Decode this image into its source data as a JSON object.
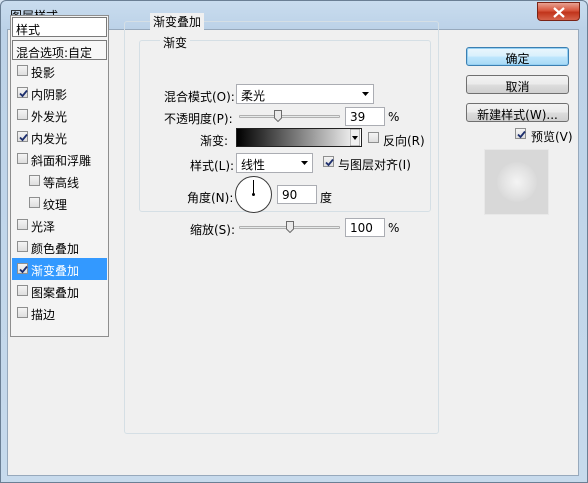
{
  "window": {
    "title": "图层样式"
  },
  "style_list": {
    "header": "样式",
    "blend_options": "混合选项:自定",
    "items": [
      {
        "label": "投影",
        "checked": false
      },
      {
        "label": "内阴影",
        "checked": true
      },
      {
        "label": "外发光",
        "checked": false
      },
      {
        "label": "内发光",
        "checked": true
      },
      {
        "label": "斜面和浮雕",
        "checked": false
      },
      {
        "label": "等高线",
        "checked": false
      },
      {
        "label": "纹理",
        "checked": false
      },
      {
        "label": "光泽",
        "checked": false
      },
      {
        "label": "颜色叠加",
        "checked": false
      },
      {
        "label": "渐变叠加",
        "checked": true,
        "selected": true
      },
      {
        "label": "图案叠加",
        "checked": false
      },
      {
        "label": "描边",
        "checked": false
      }
    ]
  },
  "panel": {
    "group_title": "渐变叠加",
    "sub_group_title": "渐变",
    "blend_mode_label": "混合模式(O):",
    "blend_mode_value": "柔光",
    "opacity_label": "不透明度(P):",
    "opacity_value": "39",
    "opacity_unit": "%",
    "opacity_fraction": 0.39,
    "gradient_label": "渐变:",
    "reverse_label": "反向(R)",
    "reverse_checked": false,
    "style_label": "样式(L):",
    "style_value": "线性",
    "align_label": "与图层对齐(I)",
    "align_checked": true,
    "angle_label": "角度(N):",
    "angle_value": "90",
    "angle_unit": "度",
    "scale_label": "缩放(S):",
    "scale_value": "100",
    "scale_unit": "%",
    "scale_fraction": 0.5
  },
  "buttons": {
    "ok": "确定",
    "cancel": "取消",
    "new_style": "新建样式(W)...",
    "preview_label": "预览(V)",
    "preview_checked": true
  },
  "colors": {
    "selection": "#3399ff",
    "close_button": "#c7402a"
  }
}
